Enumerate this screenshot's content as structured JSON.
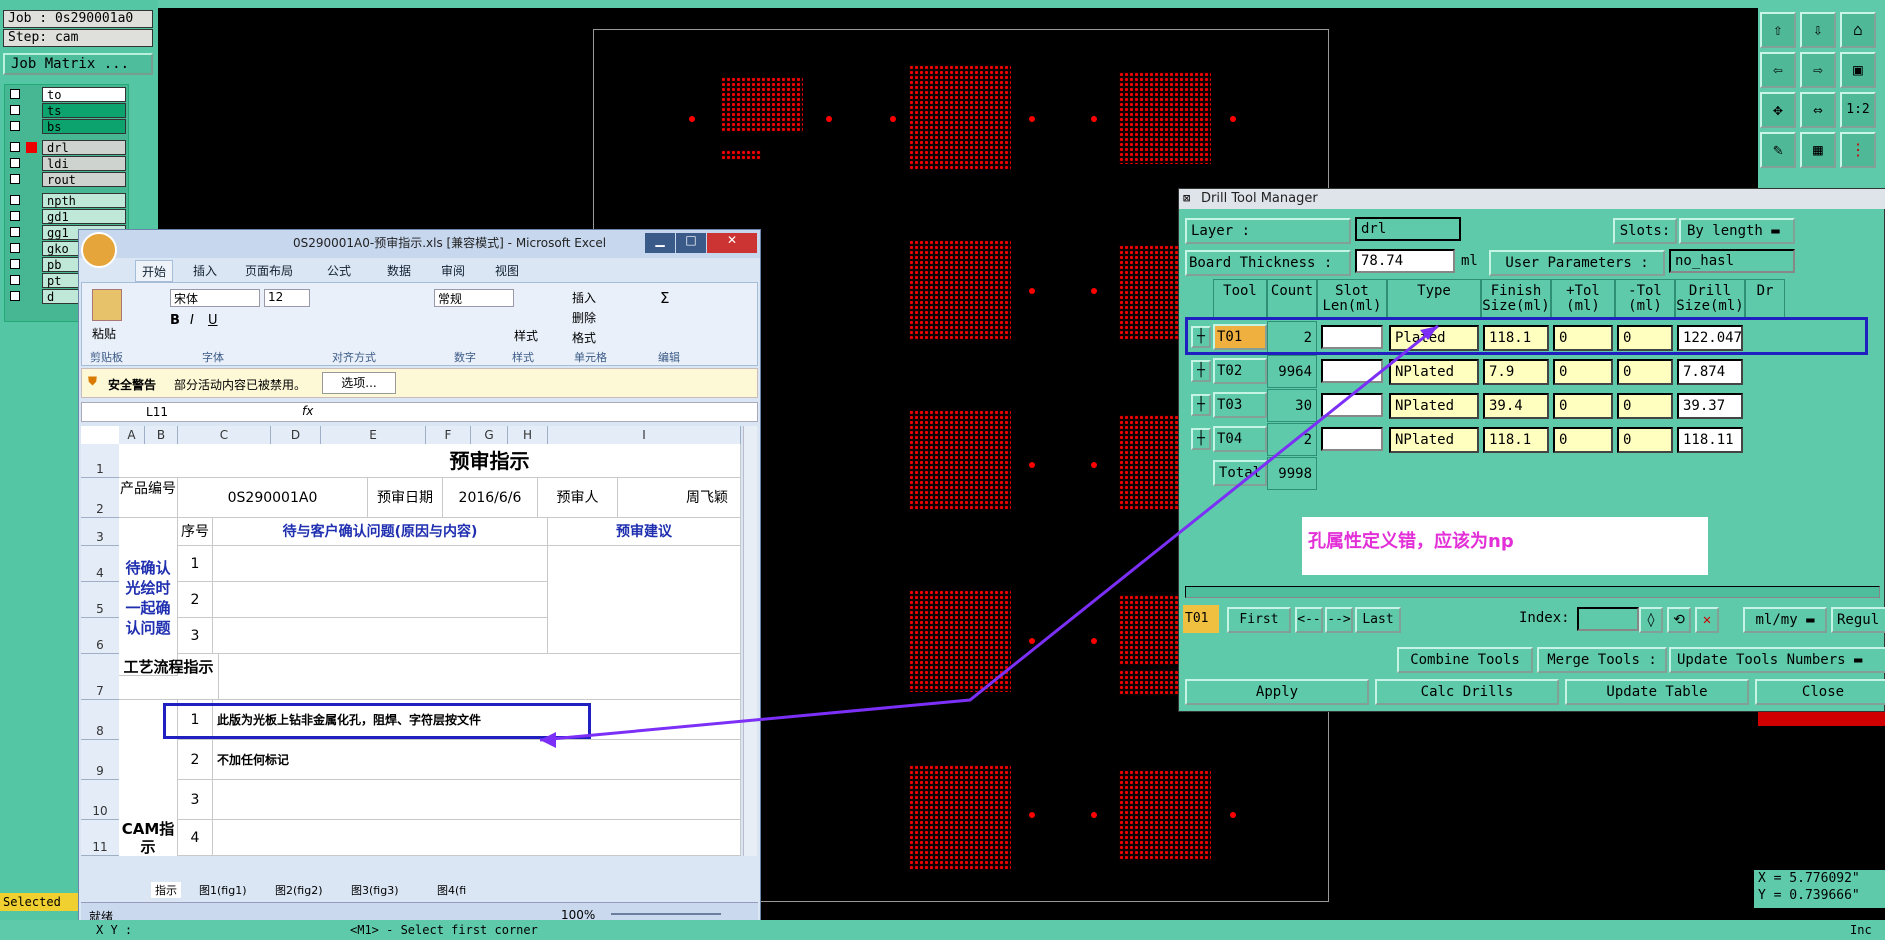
{
  "genesis": {
    "job": "Job : 0s290001a0",
    "step": "Step: cam",
    "job_matrix": "Job Matrix ...",
    "layers": [
      "to",
      "ts",
      "bs",
      "drl",
      "ldi",
      "rout",
      "npth",
      "gd1",
      "gg1",
      "gko",
      "pb",
      "pt",
      "d"
    ],
    "selected_label": "Selected",
    "status_line": "<M1> - Select first corner",
    "coord_x": "X = 5.776092\"",
    "coord_y": "Y = 0.739666\"",
    "xy_label": "X Y :",
    "units": "Inc"
  },
  "excel": {
    "title": "0S290001A0-预审指示.xls  [兼容模式] - Microsoft Excel",
    "tabs": [
      "开始",
      "插入",
      "页面布局",
      "公式",
      "数据",
      "审阅",
      "视图"
    ],
    "font_name": "宋体",
    "font_size": "12",
    "number_format": "常规",
    "groups": [
      "剪贴板",
      "字体",
      "对齐方式",
      "数字",
      "样式",
      "单元格",
      "编辑"
    ],
    "paste": "粘贴",
    "style": "样式",
    "insert": "插入",
    "delete": "删除",
    "format": "格式",
    "security_label": "安全警告",
    "security_text": "部分活动内容已被禁用。",
    "options_button": "选项...",
    "cell_ref": "L11",
    "fx": "fx",
    "columns": [
      "A",
      "B",
      "C",
      "D",
      "E",
      "F",
      "G",
      "H",
      "I"
    ],
    "rows": [
      "1",
      "2",
      "3",
      "4",
      "5",
      "6",
      "7",
      "8",
      "9",
      "10",
      "11"
    ],
    "sheet_title": "预审指示",
    "product_no_label": "产品编号",
    "product_no": "0S290001A0",
    "review_date_label": "预审日期",
    "review_date": "2016/6/6",
    "reviewer_label": "预审人",
    "reviewer": "周飞颖",
    "seq_label": "序号",
    "issue_header": "待与客户确认问题(原因与内容)",
    "advice_header": "预审建议",
    "confirm_label": "待确认光绘时一起确认问题",
    "seq": [
      "1",
      "2",
      "3"
    ],
    "process_label": "工艺流程指示",
    "cam_label": "CAM指示",
    "cam_seq": [
      "1",
      "2",
      "3",
      "4"
    ],
    "instruction_1": "此版为光板上钻非金属化孔，阻焊、字符层按文件",
    "instruction_2": "不加任何标记",
    "sheet_tabs": [
      "指示",
      "图1(fig1)",
      "图2(fig2)",
      "图3(fig3)",
      "图4(fi"
    ],
    "status": "就绪",
    "zoom": "100%"
  },
  "dtm": {
    "title": "Drill Tool Manager",
    "layer_label": "Layer            :",
    "layer_value": "drl",
    "slots_label": "Slots:",
    "slots_value": "By length",
    "thickness_label": "Board Thickness :",
    "thickness_value": "78.74",
    "thickness_unit": "ml",
    "user_params_label": "User Parameters :",
    "user_params_value": "no_hasl",
    "headers": [
      "Tool",
      "Count",
      "Slot\nLen(ml)",
      "Type",
      "Finish\nSize(ml)",
      "+Tol\n(ml)",
      "-Tol\n(ml)",
      "Drill\nSize(ml)",
      "Dr"
    ],
    "rows": [
      {
        "tool": "T01",
        "count": "2",
        "type": "Plated",
        "finish": "118.1",
        "ptol": "0",
        "ntol": "0",
        "drill": "122.047"
      },
      {
        "tool": "T02",
        "count": "9964",
        "type": "NPlated",
        "finish": "7.9",
        "ptol": "0",
        "ntol": "0",
        "drill": "7.874"
      },
      {
        "tool": "T03",
        "count": "30",
        "type": "NPlated",
        "finish": "39.4",
        "ptol": "0",
        "ntol": "0",
        "drill": "39.37"
      },
      {
        "tool": "T04",
        "count": "2",
        "type": "NPlated",
        "finish": "118.1",
        "ptol": "0",
        "ntol": "0",
        "drill": "118.11"
      }
    ],
    "total_label": "Total",
    "total_value": "9998",
    "note": "孔属性定义错，应该为np",
    "current_tool": "T01",
    "nav": [
      "First",
      "<--",
      "-->",
      "Last"
    ],
    "index_label": "Index:",
    "unit_select": "ml/my",
    "regular": "Regul",
    "combine": "Combine Tools",
    "merge_label": "Merge Tools :",
    "merge_value": "Update Tools Numbers",
    "apply": "Apply",
    "calc": "Calc Drills",
    "update": "Update Table",
    "close": "Close"
  },
  "colors": {
    "accent": "#5ecaa9",
    "pad": "#e00000",
    "annotation": "#7b2ff7",
    "highlight": "#2020c0"
  }
}
